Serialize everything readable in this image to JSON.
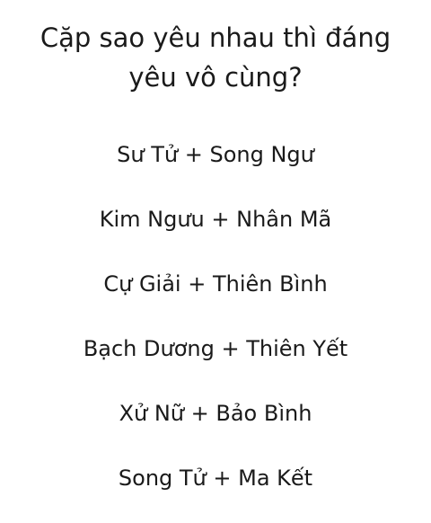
{
  "title": {
    "line1": "Cặp sao yêu nhau thì đáng",
    "line2": "yêu vô cùng?"
  },
  "pairs": [
    "Sư Tử + Song Ngư",
    "Kim Ngưu + Nhân Mã",
    "Cự Giải + Thiên Bình",
    "Bạch Dương + Thiên Yết",
    "Xử Nữ + Bảo Bình",
    "Song Tử + Ma Kết"
  ]
}
